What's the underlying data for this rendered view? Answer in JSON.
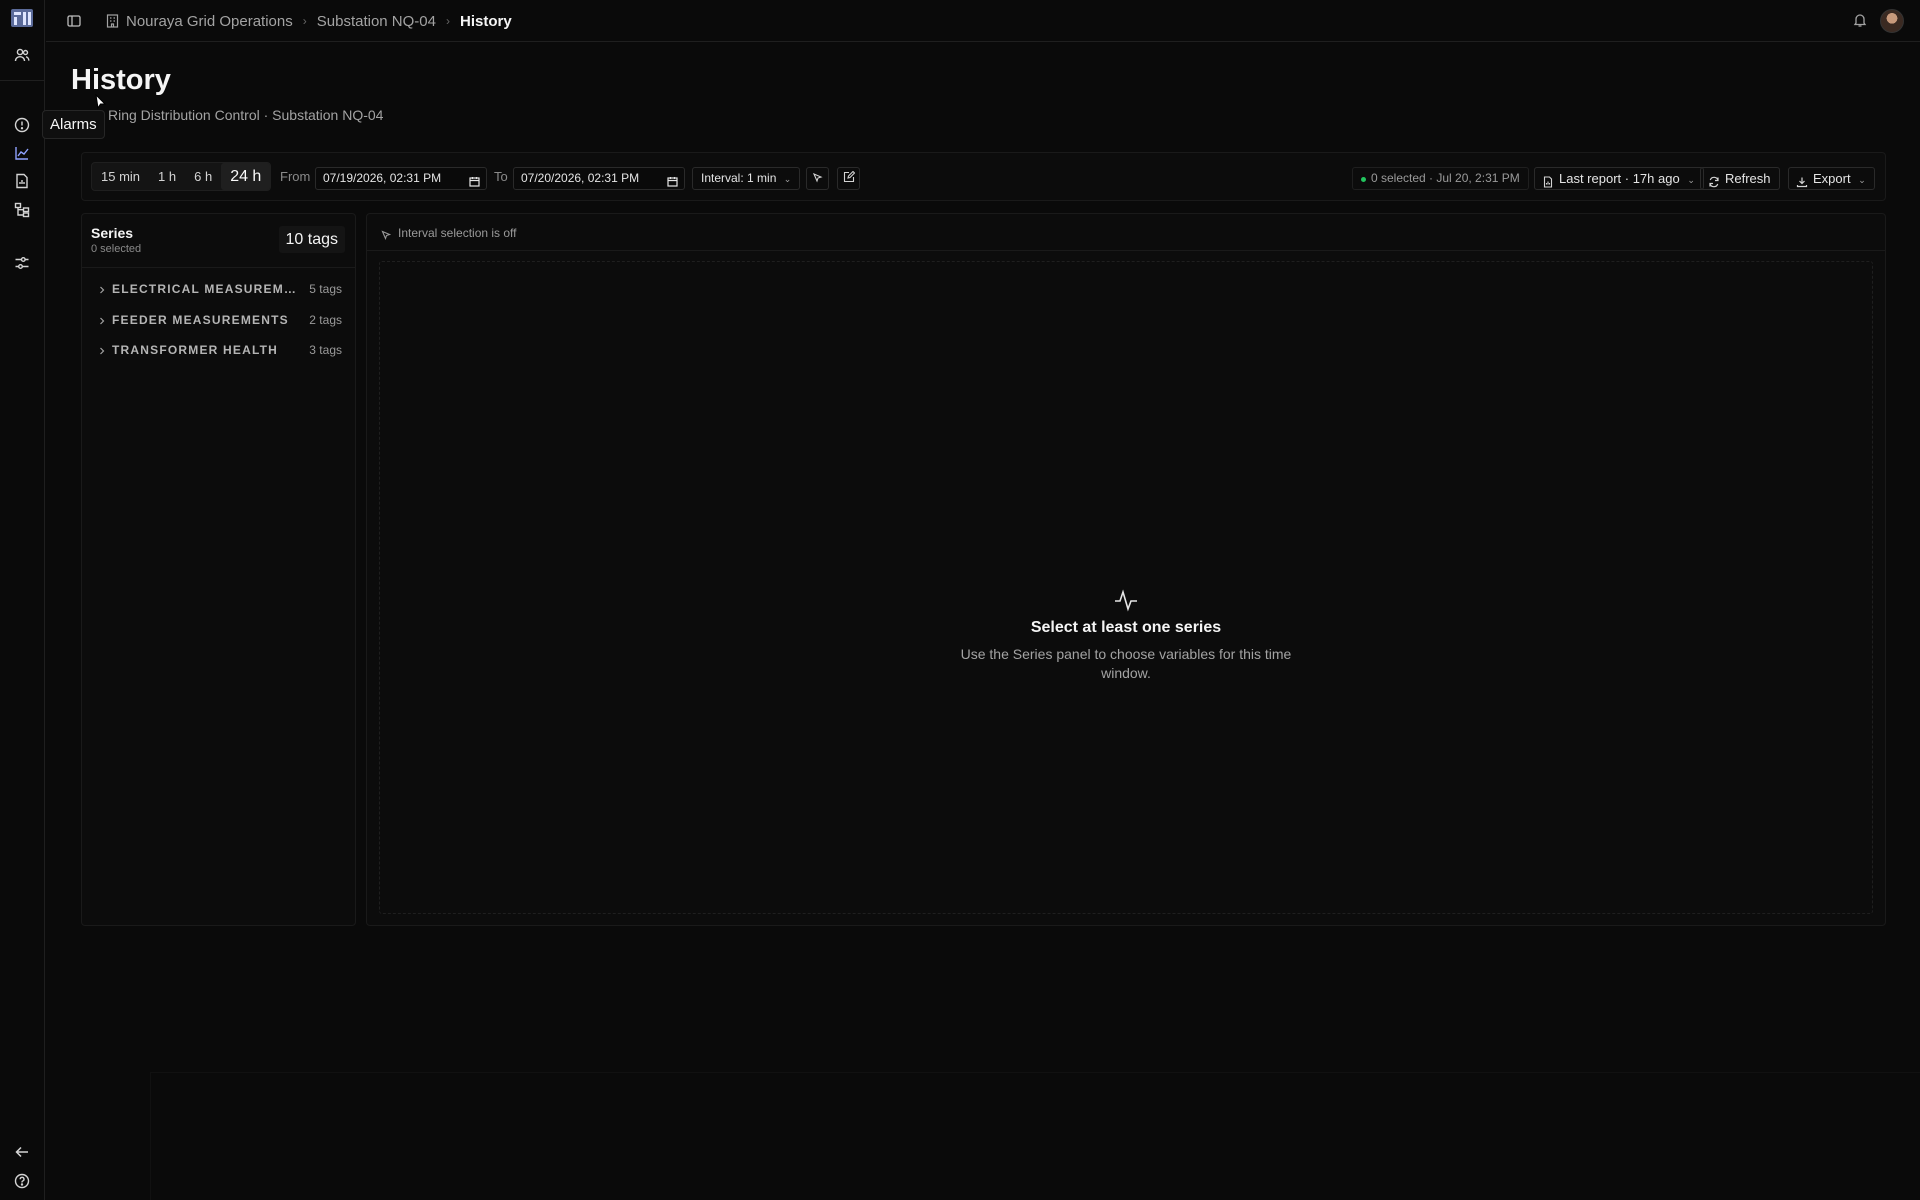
{
  "breadcrumb": {
    "org": "Nouraya Grid Operations",
    "site": "Substation NQ-04",
    "page": "History"
  },
  "page": {
    "title": "History",
    "subtitle": "Ring Distribution Control · Substation NQ-04"
  },
  "tooltip": "Alarms",
  "toolbar": {
    "ranges": [
      "15 min",
      "1 h",
      "6 h",
      "24 h"
    ],
    "active_range": "24 h",
    "from_label": "From",
    "from_value": "07/19/2026, 02:31 PM",
    "to_label": "To",
    "to_value": "07/20/2026, 02:31 PM",
    "interval": "Interval: 1 min",
    "status": "0 selected · Jul 20, 2:31 PM",
    "status_color": "#22c55e",
    "last_report": "Last report · 17h ago",
    "refresh": "Refresh",
    "export": "Export"
  },
  "series": {
    "title": "Series",
    "selected": "0 selected",
    "count": "10 tags",
    "groups": [
      {
        "name": "ELECTRICAL MEASUREMENTS",
        "tags": "5 tags"
      },
      {
        "name": "FEEDER MEASUREMENTS",
        "tags": "2 tags"
      },
      {
        "name": "TRANSFORMER HEALTH",
        "tags": "3 tags"
      }
    ]
  },
  "chart": {
    "interval_status": "Interval selection is off",
    "empty_title": "Select at least one series",
    "empty_desc": "Use the Series panel to choose variables for this time window."
  },
  "icons": [
    "logo-icon",
    "users-icon",
    "alert-circle-icon",
    "chart-line-icon",
    "report-icon",
    "hierarchy-icon",
    "sliders-icon",
    "arrow-left-icon",
    "help-icon",
    "sidebar-toggle-icon",
    "building-icon",
    "bell-icon"
  ]
}
